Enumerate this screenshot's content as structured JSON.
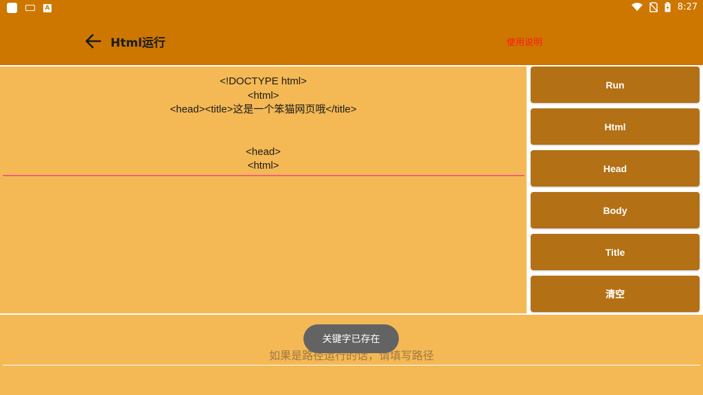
{
  "status_bar": {
    "time": "8:27",
    "icons": [
      "app-square-icon",
      "keyboard-icon",
      "font-a-icon",
      "wifi-icon",
      "no-sim-icon",
      "battery-icon"
    ]
  },
  "app_bar": {
    "title": "Html运行",
    "help_label": "使用说明",
    "background_color": "#cd7700",
    "help_color": "#ff1a1a"
  },
  "editor": {
    "code": "<!DOCTYPE html>\n<html>\n<head><title>这是一个笨猫网页哦</title>\n\n\n<head>\n<html>",
    "background_color": "#f4b955",
    "underline_color": "#f06277"
  },
  "side_buttons": [
    {
      "label": "Run"
    },
    {
      "label": "Html"
    },
    {
      "label": "Head"
    },
    {
      "label": "Body"
    },
    {
      "label": "Title"
    },
    {
      "label": "清空"
    }
  ],
  "path_field": {
    "value": "",
    "placeholder": "如果是路径运行的话，请填写路径"
  },
  "toast": {
    "text": "关键字已存在"
  }
}
